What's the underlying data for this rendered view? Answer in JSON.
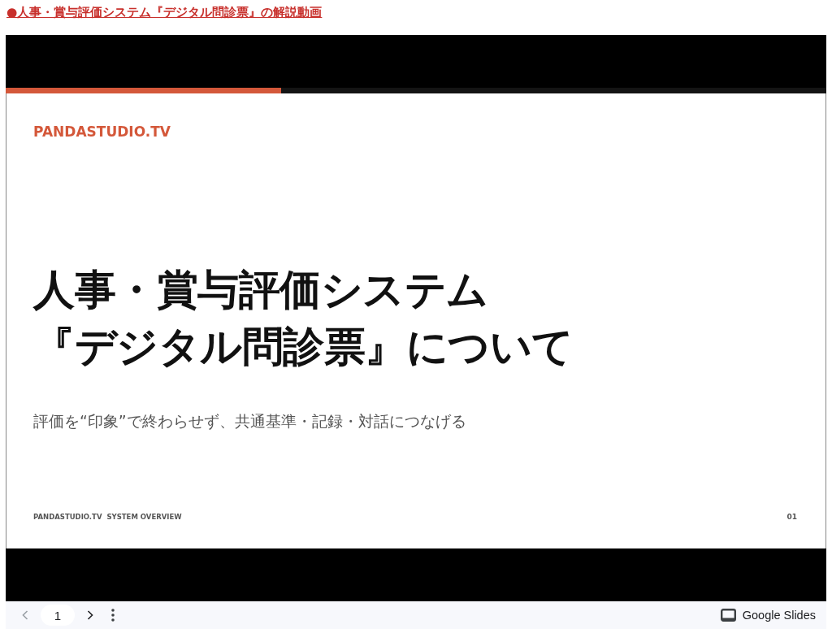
{
  "link": {
    "text": "●人事・賞与評価システム『デジタル問診票』の解説動画"
  },
  "slide": {
    "brand": "PANDASTUDIO.TV",
    "title_lines": [
      "人事・賞与評価システム",
      "『デジタル問診票』について"
    ],
    "subtitle": "評価を“印象”で終わらせず、共通基準・記録・対話につなげる",
    "footer": "PANDASTUDIO.TV  SYSTEM OVERVIEW",
    "page_number": "01"
  },
  "toolbar": {
    "prev_disabled": true,
    "page": "1",
    "next_disabled": false,
    "product": "Google Slides"
  }
}
